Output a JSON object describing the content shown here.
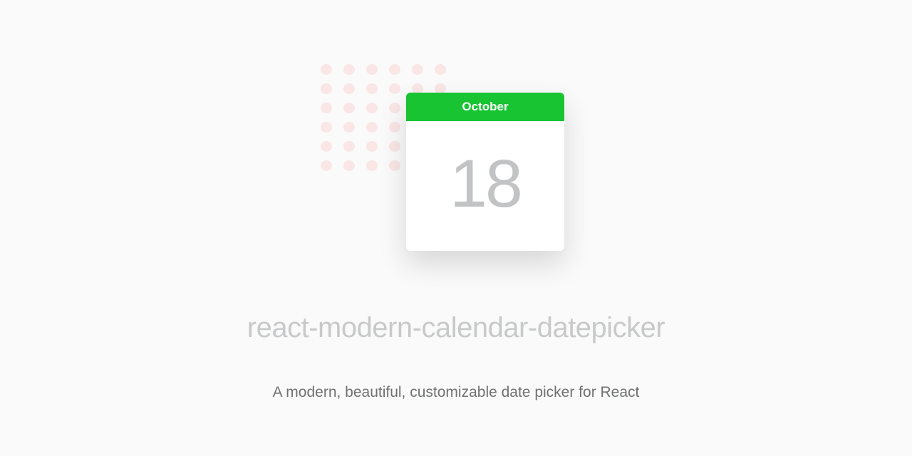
{
  "calendar": {
    "month": "October",
    "day": "18"
  },
  "title": "react-modern-calendar-datepicker",
  "subtitle": "A modern, beautiful, customizable date picker for React"
}
